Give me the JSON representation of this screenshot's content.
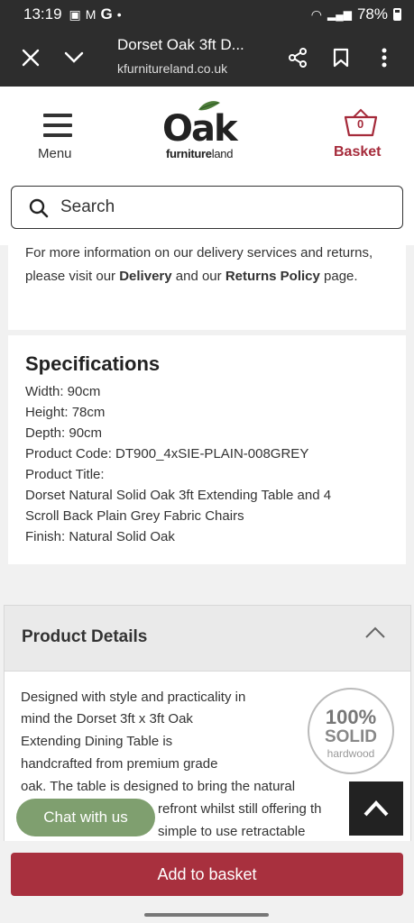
{
  "status_bar": {
    "time": "13:19",
    "battery": "78%"
  },
  "browser": {
    "title": "Dorset Oak 3ft D...",
    "url": "kfurnitureland.co.uk"
  },
  "header": {
    "menu_label": "Menu",
    "logo_main": "Oak",
    "logo_sub_bold": "furniture",
    "logo_sub_light": "land",
    "basket_label": "Basket",
    "basket_count": "0",
    "search_placeholder": "Search"
  },
  "delivery_info": {
    "prefix": "For more information on our delivery services and returns, please visit our ",
    "link1": "Delivery",
    "middle": " and our ",
    "link2": "Returns Policy",
    "suffix": " page."
  },
  "specifications": {
    "title": "Specifications",
    "lines": [
      "Width: 90cm",
      "Height: 78cm",
      "Depth: 90cm",
      "Product Code: DT900_4xSIE-PLAIN-008GREY",
      "Product Title:",
      "Dorset Natural Solid Oak 3ft Extending Table and 4",
      "Scroll Back Plain Grey Fabric Chairs",
      "Finish: Natural Solid Oak"
    ]
  },
  "product_details": {
    "title": "Product Details",
    "lines": [
      "Designed with style and practicality in",
      "mind the Dorset 3ft x 3ft Oak",
      "Extending Dining Table is",
      "handcrafted from premium grade",
      "oak. The table is designed to bring the natural",
      "refront whilst still offering th",
      "simple to use retractable"
    ],
    "badge_percent": "100%",
    "badge_solid": "SOLID",
    "badge_hardwood": "hardwood"
  },
  "chat_label": "Chat with us",
  "add_to_basket_label": "Add to basket",
  "colors": {
    "brand_red": "#a8303e",
    "chat_green": "#7f9f6f"
  },
  "icons": [
    "close-icon",
    "chevron-down-icon",
    "share-icon",
    "bookmark-icon",
    "more-vert-icon",
    "menu-icon",
    "basket-icon",
    "search-icon",
    "chevron-up-icon"
  ]
}
